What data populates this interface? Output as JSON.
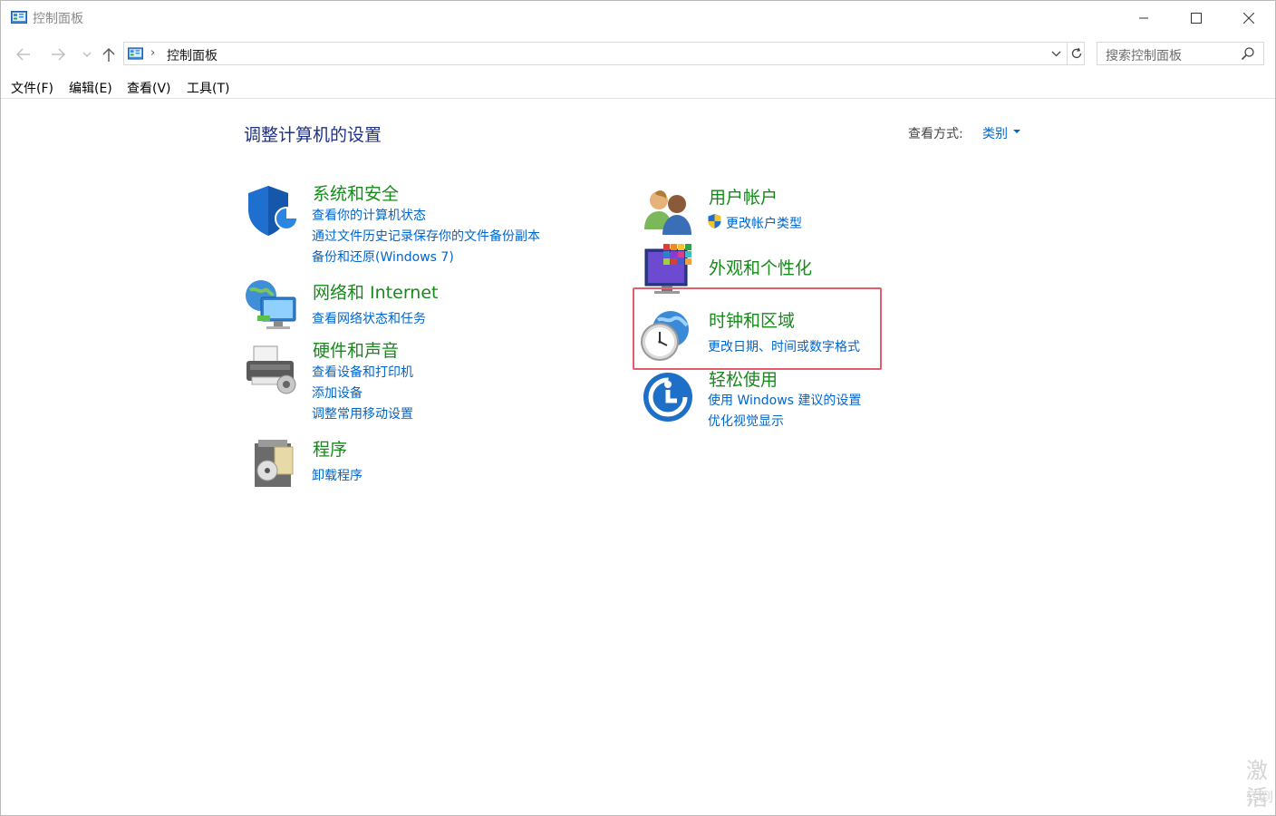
{
  "window": {
    "title": "控制面板"
  },
  "address": {
    "path": "控制面板",
    "separator": "›"
  },
  "search": {
    "placeholder": "搜索控制面板"
  },
  "menu": {
    "file": "文件(F)",
    "edit": "编辑(E)",
    "view": "查看(V)",
    "tools": "工具(T)"
  },
  "content": {
    "heading": "调整计算机的设置",
    "view_by_label": "查看方式:",
    "view_by_value": "类别"
  },
  "categories": {
    "system_security": {
      "title": "系统和安全",
      "links": [
        "查看你的计算机状态",
        "通过文件历史记录保存你的文件备份副本",
        "备份和还原(Windows 7)"
      ]
    },
    "network": {
      "title": "网络和 Internet",
      "links": [
        "查看网络状态和任务"
      ]
    },
    "hardware": {
      "title": "硬件和声音",
      "links": [
        "查看设备和打印机",
        "添加设备",
        "调整常用移动设置"
      ]
    },
    "programs": {
      "title": "程序",
      "links": [
        "卸载程序"
      ]
    },
    "user_accounts": {
      "title": "用户帐户",
      "links": [
        "更改帐户类型"
      ]
    },
    "appearance": {
      "title": "外观和个性化",
      "links": []
    },
    "clock_region": {
      "title": "时钟和区域",
      "links": [
        "更改日期、时间或数字格式"
      ]
    },
    "ease_of_access": {
      "title": "轻松使用",
      "links": [
        "使用 Windows 建议的设置",
        "优化视觉显示"
      ]
    }
  },
  "watermark": {
    "line1": "激活",
    "line2": "转到"
  },
  "colors": {
    "category_title": "#168a1a",
    "link": "#0066cc",
    "heading": "#1e3287",
    "highlight": "#e45d6b"
  }
}
